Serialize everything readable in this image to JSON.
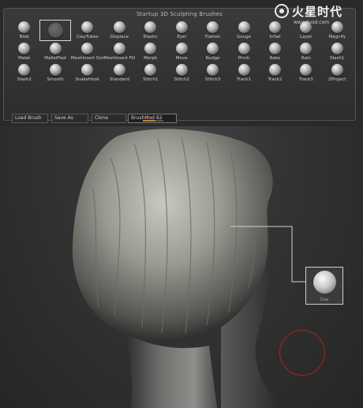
{
  "palette": {
    "title": "Startup 3D Sculpting Brushes",
    "brushes": [
      {
        "label": "Blob"
      },
      {
        "label": "",
        "selected": true
      },
      {
        "label": "ClayTubes"
      },
      {
        "label": "Displace"
      },
      {
        "label": "Elastic"
      },
      {
        "label": "Eyel"
      },
      {
        "label": "Flatten"
      },
      {
        "label": "Gouge"
      },
      {
        "label": "Inflat"
      },
      {
        "label": "Layer"
      },
      {
        "label": "Magnify"
      },
      {
        "label": "Malet"
      },
      {
        "label": "MalletFast"
      },
      {
        "label": "MeshInsert Dot"
      },
      {
        "label": "MeshInsert Fill"
      },
      {
        "label": "Morph"
      },
      {
        "label": "Move"
      },
      {
        "label": "Nudge"
      },
      {
        "label": "Pinch"
      },
      {
        "label": "Rake"
      },
      {
        "label": "Rain"
      },
      {
        "label": "Slash1"
      },
      {
        "label": "Slash2"
      },
      {
        "label": "Smooth"
      },
      {
        "label": "SnakeHook"
      },
      {
        "label": "Standard"
      },
      {
        "label": "Stitch1"
      },
      {
        "label": "Stitch2"
      },
      {
        "label": "Stitch3"
      },
      {
        "label": "Track1"
      },
      {
        "label": "Track2"
      },
      {
        "label": "Track3"
      },
      {
        "label": "ZProject"
      }
    ],
    "buttons": {
      "load": "Load Brush",
      "save": "Save As",
      "clone": "Clone",
      "brushmod": "BrushMod 62"
    },
    "brushmod_level": 0.62
  },
  "viewport": {
    "thumbnail_label": "Clay",
    "accent_circle_color": "#b02020"
  },
  "watermark": {
    "title": "火星时代",
    "url": "www.hxsd.com"
  }
}
